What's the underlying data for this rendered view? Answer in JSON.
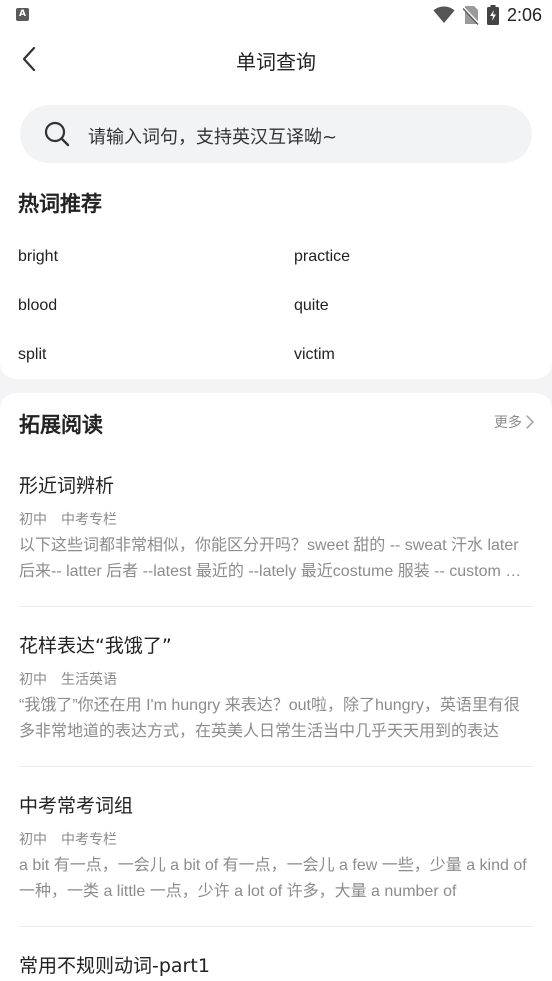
{
  "status": {
    "time": "2:06",
    "app_badge": "A"
  },
  "header": {
    "title": "单词查询"
  },
  "search": {
    "placeholder": "请输入词句，支持英汉互译呦~"
  },
  "hot": {
    "title": "热词推荐",
    "words": [
      "bright",
      "practice",
      "blood",
      "quite",
      "split",
      "victim"
    ]
  },
  "reading": {
    "title": "拓展阅读",
    "more_label": "更多",
    "articles": [
      {
        "title": "形近词辨析",
        "tags": [
          "初中",
          "中考专栏"
        ],
        "excerpt": "以下这些词都非常相似，你能区分开吗？sweet 甜的 -- sweat 汗水 later 后来-- latter 后者 --latest 最近的 --lately 最近costume 服装 -- custom 习惯"
      },
      {
        "title": "花样表达“我饿了”",
        "tags": [
          "初中",
          "生活英语"
        ],
        "excerpt": "“我饿了”你还在用 I'm hungry 来表达？out啦，除了hungry，英语里有很多非常地道的表达方式，在英美人日常生活当中几乎天天用到的表达"
      },
      {
        "title": "中考常考词组",
        "tags": [
          "初中",
          "中考专栏"
        ],
        "excerpt": "a bit 有一点，一会儿 a bit of 有一点，一会儿 a few 一些，少量 a kind of  一种，一类 a little  一点，少许 a lot of 许多，大量 a number of"
      },
      {
        "title": "常用不规则动词-part1",
        "tags": [],
        "excerpt": ""
      }
    ]
  }
}
